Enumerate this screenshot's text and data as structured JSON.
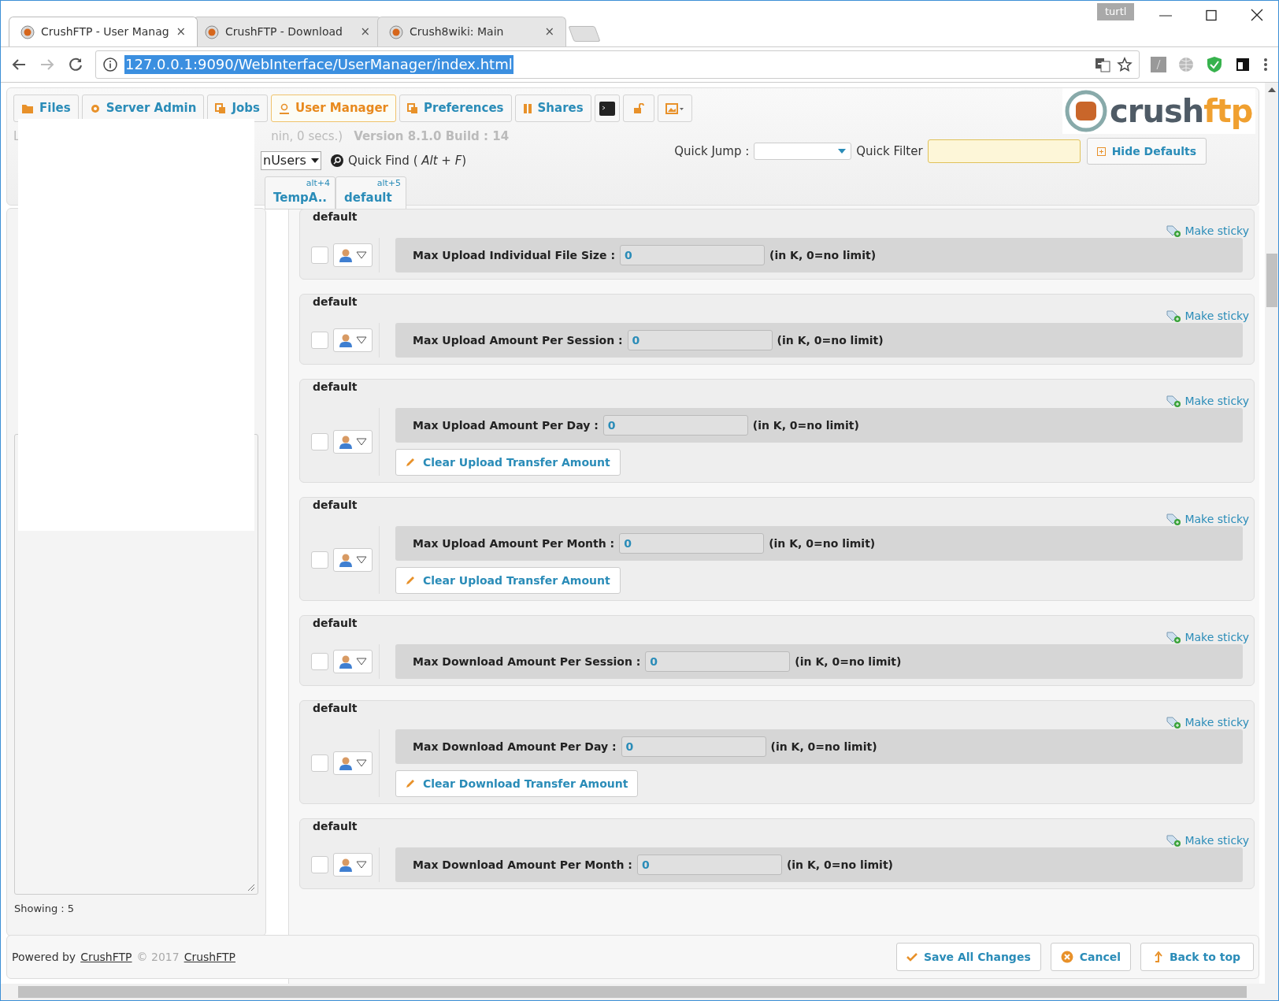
{
  "browser": {
    "profile": "turtl",
    "tabs": [
      {
        "title": "CrushFTP - User Manag",
        "selected": true,
        "close": "×"
      },
      {
        "title": "CrushFTP - Download",
        "selected": false,
        "close": "×"
      },
      {
        "title": "Crush8wiki: Main",
        "selected": false,
        "close": "×"
      }
    ],
    "url": "127.0.0.1:9090/WebInterface/UserManager/index.html"
  },
  "nav": [
    {
      "label": "Files",
      "selected": false,
      "kind": "folder"
    },
    {
      "label": "Server Admin",
      "selected": false,
      "kind": "gear"
    },
    {
      "label": "Jobs",
      "selected": false,
      "kind": "copy"
    },
    {
      "label": "User Manager",
      "selected": true,
      "kind": "user"
    },
    {
      "label": "Preferences",
      "selected": false,
      "kind": "copy"
    },
    {
      "label": "Shares",
      "selected": false,
      "kind": "book"
    }
  ],
  "header": {
    "logo_parts": [
      "crush",
      "ftp"
    ],
    "login_fragment": "L",
    "session_fragment": "nin, 0 secs.)",
    "version": "Version 8.1.0 Build : 14",
    "user_list": "nUsers",
    "quick_find": "Quick Find ( *Alt* + *F*)",
    "user_tabs": [
      {
        "label": "TempA..",
        "shortcut": "alt+4"
      },
      {
        "label": "default",
        "shortcut": "alt+5"
      }
    ],
    "quick_jump_label": "Quick Jump :",
    "quick_filter_label": "Quick Filter",
    "hide_defaults": "Hide Defaults"
  },
  "left_panel": {
    "showing": "Showing : 5"
  },
  "settings": [
    {
      "legend": "default",
      "label": "Max Upload Individual File Size :",
      "value": "0",
      "unit": "(in K, 0=no limit)",
      "sticky": "Make sticky",
      "checked": false
    },
    {
      "legend": "default",
      "label": "Max Upload Amount Per Session :",
      "value": "0",
      "unit": "(in K, 0=no limit)",
      "sticky": "Make sticky",
      "checked": false
    },
    {
      "legend": "default",
      "label": "Max Upload Amount Per Day :",
      "value": "0",
      "unit": "(in K, 0=no limit)",
      "sticky": "Make sticky",
      "checked": false,
      "action": "Clear Upload Transfer Amount"
    },
    {
      "legend": "default",
      "label": "Max Upload Amount Per Month :",
      "value": "0",
      "unit": "(in K, 0=no limit)",
      "sticky": "Make sticky",
      "checked": false,
      "action": "Clear Upload Transfer Amount"
    },
    {
      "legend": "default",
      "label": "Max Download Amount Per Session :",
      "value": "0",
      "unit": "(in K, 0=no limit)",
      "sticky": "Make sticky",
      "checked": false
    },
    {
      "legend": "default",
      "label": "Max Download Amount Per Day :",
      "value": "0",
      "unit": "(in K, 0=no limit)",
      "sticky": "Make sticky",
      "checked": false,
      "action": "Clear Download Transfer Amount"
    },
    {
      "legend": "default",
      "label": "Max Download Amount Per Month :",
      "value": "0",
      "unit": "(in K, 0=no limit)",
      "sticky": "Make sticky",
      "checked": false
    }
  ],
  "footer": {
    "powered_by": "Powered by",
    "link1": "CrushFTP",
    "copyright": "© 2017",
    "link2": "CrushFTP",
    "buttons": [
      {
        "label": "Save All Changes",
        "kind": "save"
      },
      {
        "label": "Cancel",
        "kind": "cancel"
      },
      {
        "label": "Back to top",
        "kind": "top"
      }
    ]
  }
}
